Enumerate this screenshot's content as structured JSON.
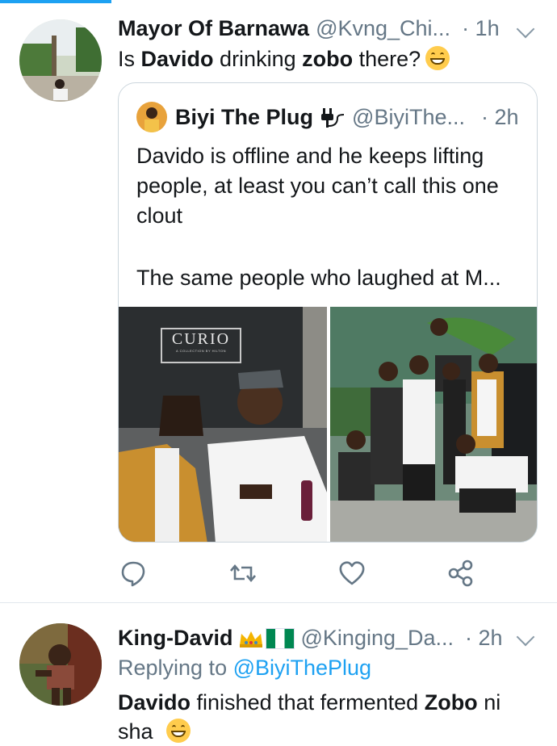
{
  "tweet1": {
    "name": "Mayor Of Barnawa",
    "handle": "@Kvng_Chi...",
    "time": "· 1h",
    "text_pre": "Is ",
    "text_bold1": "Davido",
    "text_mid": " drinking ",
    "text_bold2": "zobo",
    "text_post": " there?",
    "emoji": "grinning-face"
  },
  "quote": {
    "name": "Biyi The Plug",
    "handle": "@BiyiThe...",
    "time": "· 2h",
    "name_icon": "electric-plug",
    "lines": [
      "Davido is offline and he keeps lifting",
      "people, at least you can’t call this one",
      "clout",
      "The same people who laughed at M..."
    ],
    "photo_left_sign": "CURIO",
    "photo_left_sign_sub": "A COLLECTION BY HILTON"
  },
  "actions": [
    "reply-icon",
    "retweet-icon",
    "like-icon",
    "share-icon"
  ],
  "tweet2": {
    "name": "King-David",
    "handle": "@Kinging_Da...",
    "time": "· 2h",
    "name_emojis": [
      "crown",
      "nigeria-flag"
    ],
    "replying_label": "Replying to ",
    "replying_handle": "@BiyiThePlug",
    "text_bold1": "Davido",
    "text_mid": " finished that fermented ",
    "text_bold2": "Zobo",
    "text_post": " ni",
    "text_line2": "sha"
  },
  "colors": {
    "accent": "#1da1f2",
    "secondary_text": "#657786",
    "border": "#ccd6dd"
  }
}
